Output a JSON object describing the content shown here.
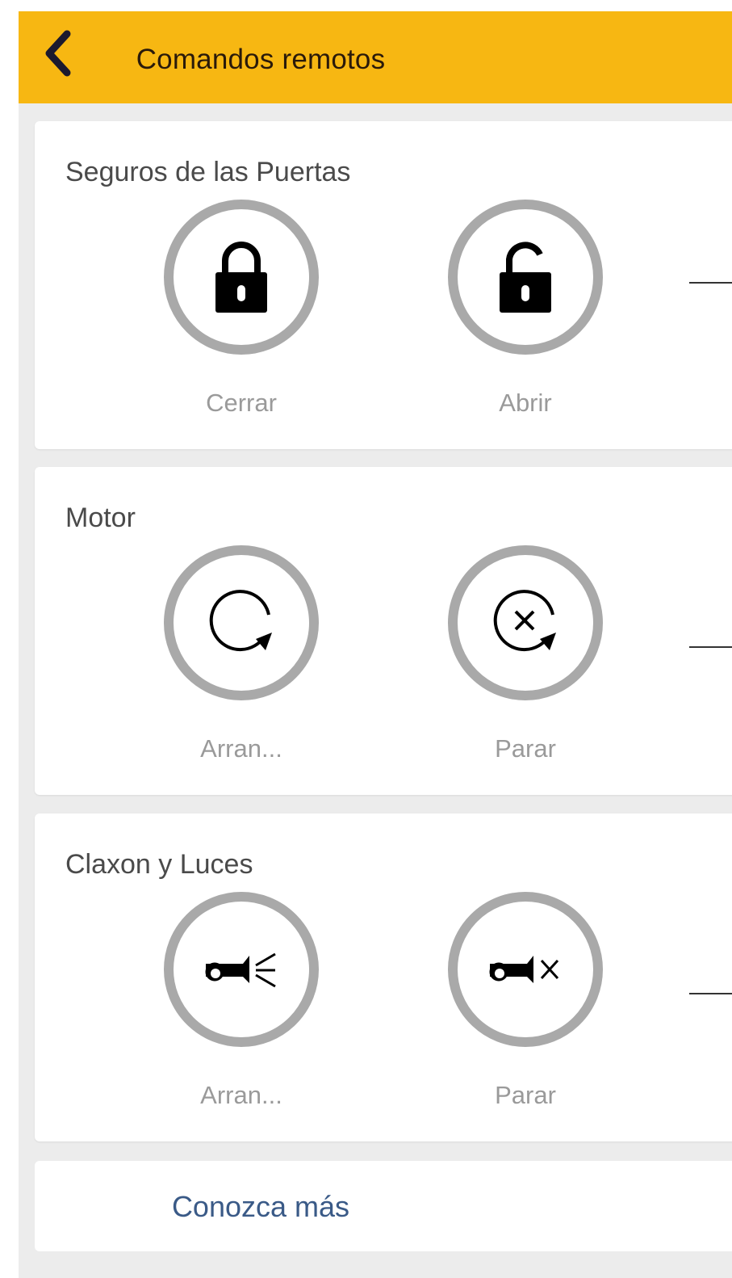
{
  "header": {
    "title": "Comandos remotos",
    "back_icon": "chevron-left-icon",
    "color": "#f7b712"
  },
  "sections": [
    {
      "title": "Seguros de las Puertas",
      "buttons": [
        {
          "label": "Cerrar",
          "icon": "lock-closed-icon"
        },
        {
          "label": "Abrir",
          "icon": "lock-open-icon"
        }
      ]
    },
    {
      "title": "Motor",
      "buttons": [
        {
          "label": "Arran...",
          "icon": "engine-start-icon"
        },
        {
          "label": "Parar",
          "icon": "engine-stop-icon"
        }
      ]
    },
    {
      "title": "Claxon y Luces",
      "buttons": [
        {
          "label": "Arran...",
          "icon": "horn-icon"
        },
        {
          "label": "Parar",
          "icon": "horn-stop-icon"
        }
      ]
    }
  ],
  "learn_more": {
    "label": "Conozca más",
    "color": "#3a5a87"
  }
}
